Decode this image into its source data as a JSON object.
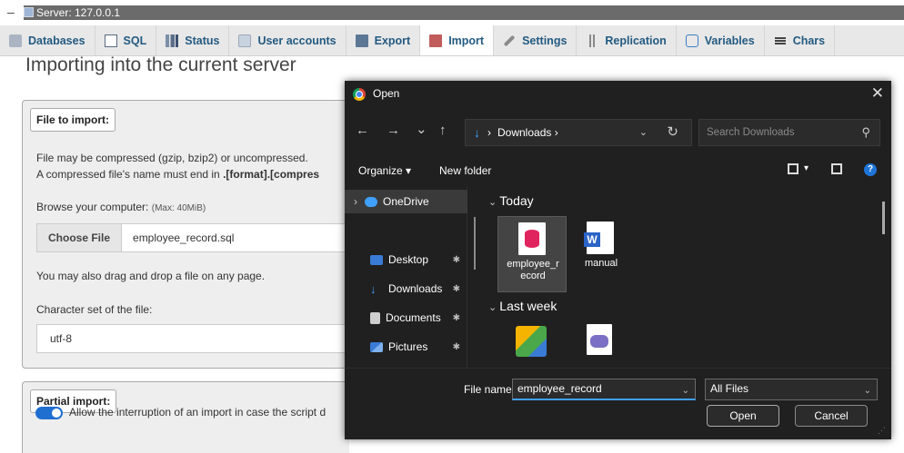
{
  "server_bar": {
    "label": "Server: 127.0.0.1"
  },
  "tabs": [
    {
      "label": "Databases",
      "icon": "database-icon"
    },
    {
      "label": "SQL",
      "icon": "sql-icon"
    },
    {
      "label": "Status",
      "icon": "status-icon"
    },
    {
      "label": "User accounts",
      "icon": "users-icon"
    },
    {
      "label": "Export",
      "icon": "export-icon"
    },
    {
      "label": "Import",
      "icon": "import-icon",
      "active": true
    },
    {
      "label": "Settings",
      "icon": "wrench-icon"
    },
    {
      "label": "Replication",
      "icon": "replication-icon"
    },
    {
      "label": "Variables",
      "icon": "variables-icon"
    },
    {
      "label": "Chars",
      "icon": "charsets-icon"
    }
  ],
  "page": {
    "title": "Importing into the current server",
    "file_to_import": {
      "legend": "File to import:",
      "line1": "File may be compressed (gzip, bzip2) or uncompressed.",
      "line2_prefix": "A compressed file's name must end in ",
      "line2_bold": ".[format].[compres",
      "browse_label": "Browse your computer:",
      "browse_max": "(Max: 40MiB)",
      "choose_file_label": "Choose File",
      "chosen_file": "employee_record.sql",
      "drag_hint": "You may also drag and drop a file on any page.",
      "charset_label": "Character set of the file:",
      "charset_value": "utf-8"
    },
    "partial_import": {
      "legend": "Partial import:",
      "allow_interruption": "Allow the interruption of an import in case the script d"
    }
  },
  "dialog": {
    "title": "Open",
    "close_glyph": "✕",
    "nav": {
      "back": "←",
      "forward": "→",
      "down": "⌄",
      "up": "↑"
    },
    "address": {
      "crumb": "Downloads ›",
      "chevron": "⌄",
      "refresh": "↻",
      "arrow": "↓",
      "lead": "›"
    },
    "search_placeholder": "Search Downloads",
    "commands": {
      "organize": "Organize ▾",
      "new_folder": "New folder"
    },
    "nav_pane": [
      {
        "label": "OneDrive",
        "expand": "›",
        "color": "#3fa0ff"
      },
      {
        "label": "Desktop",
        "pin": "📌",
        "color": "#3a7bd5"
      },
      {
        "label": "Downloads",
        "pin": "📌",
        "color": "#3fa0ff"
      },
      {
        "label": "Documents",
        "pin": "📌",
        "color": "#cfcfcf"
      },
      {
        "label": "Pictures",
        "pin": "📌",
        "color": "#3a7bd5"
      }
    ],
    "groups": {
      "today": "Today",
      "last_week": "Last week"
    },
    "files": {
      "employee_record": "employee_r ecord",
      "manual": "manual"
    },
    "file_name_label": "File name:",
    "file_name_value": "employee_record",
    "file_type": "All Files",
    "open_button": "Open",
    "cancel_button": "Cancel"
  }
}
